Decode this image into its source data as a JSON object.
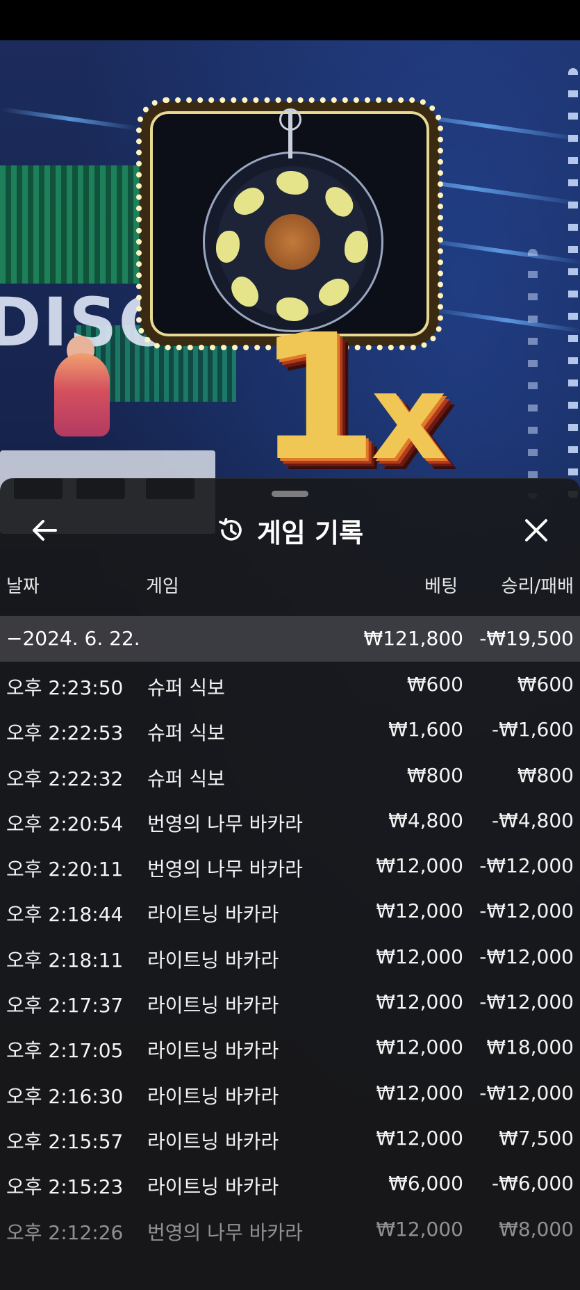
{
  "game_view": {
    "backdrop_text": "DISC",
    "multiplier_number": "1",
    "multiplier_suffix": "x"
  },
  "history_sheet": {
    "title": "게임 기록",
    "columns": {
      "date": "날짜",
      "game": "게임",
      "bet": "베팅",
      "win_loss": "승리/패배"
    },
    "day": {
      "date": "−2024. 6. 22.",
      "total_bet": "₩121,800",
      "total_win_loss": "-₩19,500"
    },
    "rows": [
      {
        "time": "오후 2:23:50",
        "game": "슈퍼 식보",
        "bet": "₩600",
        "result": "₩600"
      },
      {
        "time": "오후 2:22:53",
        "game": "슈퍼 식보",
        "bet": "₩1,600",
        "result": "-₩1,600"
      },
      {
        "time": "오후 2:22:32",
        "game": "슈퍼 식보",
        "bet": "₩800",
        "result": "₩800"
      },
      {
        "time": "오후 2:20:54",
        "game": "번영의 나무 바카라",
        "bet": "₩4,800",
        "result": "-₩4,800"
      },
      {
        "time": "오후 2:20:11",
        "game": "번영의 나무 바카라",
        "bet": "₩12,000",
        "result": "-₩12,000"
      },
      {
        "time": "오후 2:18:44",
        "game": "라이트닝 바카라",
        "bet": "₩12,000",
        "result": "-₩12,000"
      },
      {
        "time": "오후 2:18:11",
        "game": "라이트닝 바카라",
        "bet": "₩12,000",
        "result": "-₩12,000"
      },
      {
        "time": "오후 2:17:37",
        "game": "라이트닝 바카라",
        "bet": "₩12,000",
        "result": "-₩12,000"
      },
      {
        "time": "오후 2:17:05",
        "game": "라이트닝 바카라",
        "bet": "₩12,000",
        "result": "₩18,000"
      },
      {
        "time": "오후 2:16:30",
        "game": "라이트닝 바카라",
        "bet": "₩12,000",
        "result": "-₩12,000"
      },
      {
        "time": "오후 2:15:57",
        "game": "라이트닝 바카라",
        "bet": "₩12,000",
        "result": "₩7,500"
      },
      {
        "time": "오후 2:15:23",
        "game": "라이트닝 바카라",
        "bet": "₩6,000",
        "result": "-₩6,000"
      },
      {
        "time": "오후 2:12:26",
        "game": "번영의 나무 바카라",
        "bet": "₩12,000",
        "result": "₩8,000"
      }
    ]
  },
  "icons": {
    "back": "arrow-left-icon",
    "history": "history-clock-icon",
    "close": "close-x-icon"
  }
}
